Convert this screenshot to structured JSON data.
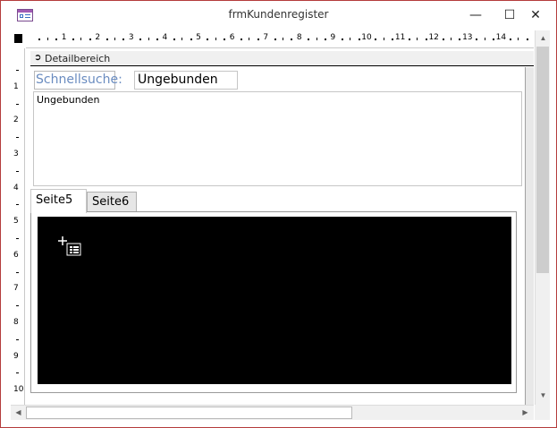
{
  "window": {
    "title": "frmKundenregister",
    "minimize_glyph": "—",
    "maximize_glyph": "☐",
    "close_glyph": "✕"
  },
  "ruler": {
    "horizontal_labels": [
      "1",
      "2",
      "3",
      "4",
      "5",
      "6",
      "7",
      "8",
      "9",
      "10",
      "11",
      "12",
      "13",
      "14"
    ],
    "vertical_labels": [
      "1",
      "2",
      "3",
      "4",
      "5",
      "6",
      "7",
      "8",
      "9",
      "10"
    ]
  },
  "section": {
    "label": "Detailbereich",
    "icon": "section-arrow-icon"
  },
  "form": {
    "search_label": "Schnellsuche:",
    "search_textbox": "Ungebunden",
    "listbox_value": "Ungebunden"
  },
  "tabs": [
    {
      "label": "Seite5",
      "active": true
    },
    {
      "label": "Seite6",
      "active": false
    }
  ],
  "subform": {
    "icon": "subform-icon"
  },
  "colors": {
    "window_border": "#b43c3c",
    "label_text": "#6a8cc0",
    "subform_fill": "#000000"
  }
}
